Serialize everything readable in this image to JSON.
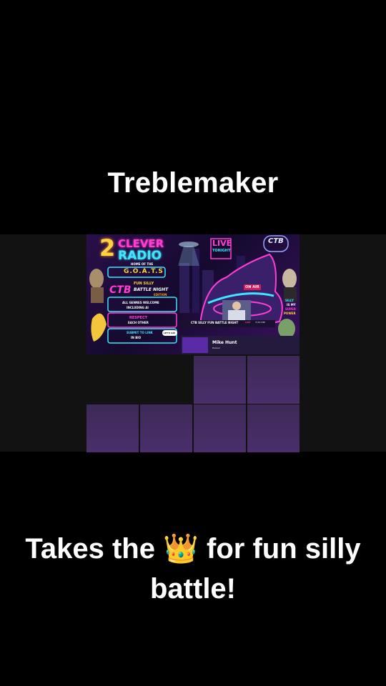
{
  "title": "Treblemaker",
  "caption": {
    "before": "Takes the ",
    "emoji": "👑",
    "after": " for fun silly",
    "line2": "battle!"
  },
  "art": {
    "number": "2",
    "clever": "CLEVER",
    "radio": "RADIO",
    "home": "HOME OF THE",
    "goats": "G.O.A.T.S",
    "live": "LIVE",
    "tonight": "TONIGHT",
    "ctb": "CTB",
    "fun_silly": "FUN SILLY",
    "battle_night": "BATTLE NIGHT",
    "edition": "EDITION",
    "genres": "ALL GENRES WELCOME",
    "including_ai": "INCLUDING AI",
    "respect": "RESPECT",
    "each_other": "EACH OTHER",
    "submit": "SUBMIT TO LINK",
    "in_bio": "IN BIO",
    "on_air": "ON AIR",
    "silly": "SILLY",
    "is_my": "IS MY",
    "super": "SUPER",
    "power": "POWER",
    "lets_go": "LET'S GO!",
    "banner": "CTB SILLY FUN BATTLE NIGHT",
    "banner_status": "LIVE",
    "banner_time": "7:43 PM"
  },
  "participant": {
    "name": "Mike Hunt",
    "sub": "Ended"
  },
  "colors": {
    "background": "#000000",
    "band": "#121212",
    "tile": "#44305f",
    "neon_pink": "#ff3fd1",
    "neon_cyan": "#3fe6ff",
    "neon_yellow": "#ffd23f"
  }
}
